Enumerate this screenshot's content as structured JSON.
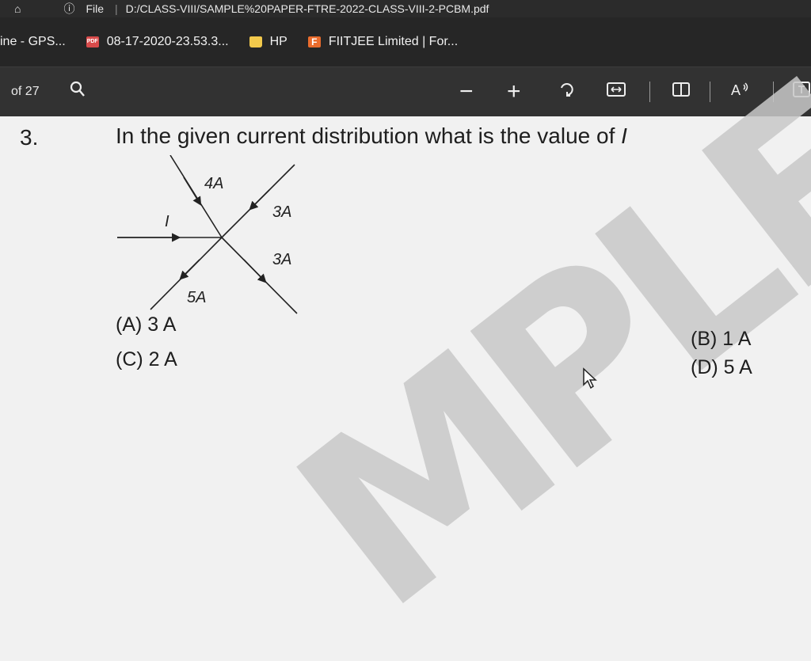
{
  "browser": {
    "top_tab_text": "File",
    "address_text": "D:/CLASS-VIII/SAMPLE%20PAPER-FTRE-2022-CLASS-VIII-2-PCBM.pdf"
  },
  "bookmarks": [
    {
      "label": "ine - GPS...",
      "icon": "none"
    },
    {
      "label": "08-17-2020-23.53.3...",
      "icon": "pdf-icon"
    },
    {
      "label": "HP",
      "icon": "folder-icon"
    },
    {
      "label": "FIITJEE Limited | For...",
      "icon": "f-icon"
    }
  ],
  "pdf_toolbar": {
    "page_text": "of 27",
    "zoom_out": "−",
    "zoom_in": "+"
  },
  "question": {
    "number": "3.",
    "text": "In the given current distribution what is the value of",
    "variable": "I"
  },
  "diagram": {
    "labels": {
      "top": "4A",
      "left": "I",
      "upper_right": "3A",
      "lower_right": "3A",
      "bottom": "5A"
    }
  },
  "options": {
    "a": "(A) 3 A",
    "b": "(B) 1 A",
    "c": "(C) 2 A",
    "d": "(D) 5 A"
  },
  "watermark": "MPLE",
  "colors": {
    "chrome_dark": "#262626",
    "toolbar": "#323232",
    "page_bg": "#f1f1f1",
    "watermark": "#c9c9c9"
  }
}
